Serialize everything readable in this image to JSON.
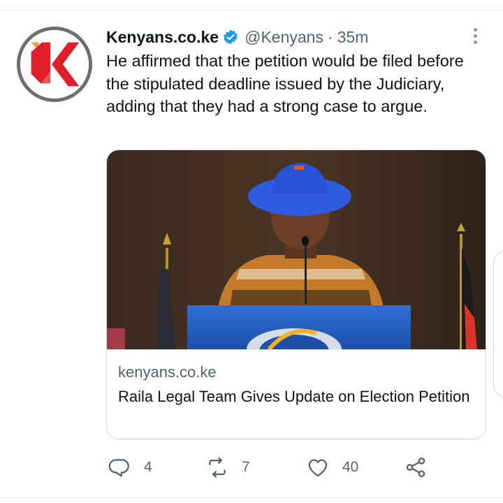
{
  "tweet": {
    "display_name": "Kenyans.co.ke",
    "handle": "@Kenyans",
    "separator": "·",
    "time": "35m",
    "text": "He affirmed that the petition would be filed before the stipulated deadline issued by the Judiciary, adding that they had a strong case to argue.",
    "verified": true
  },
  "card": {
    "domain": "kenyans.co.ke",
    "title": "Raila Legal Team Gives Update on Election Petition"
  },
  "actions": {
    "reply_count": "4",
    "retweet_count": "7",
    "like_count": "40"
  },
  "icons": {
    "verified": "verified-badge-icon",
    "more": "more-options-icon",
    "reply": "reply-icon",
    "retweet": "retweet-icon",
    "like": "like-icon",
    "share": "share-icon"
  },
  "colors": {
    "brand_red": "#e11d2a",
    "brand_orange": "#f29a2e",
    "verified_blue": "#1d9bf0",
    "secondary_text": "#536471",
    "primary_text": "#0f1419"
  }
}
